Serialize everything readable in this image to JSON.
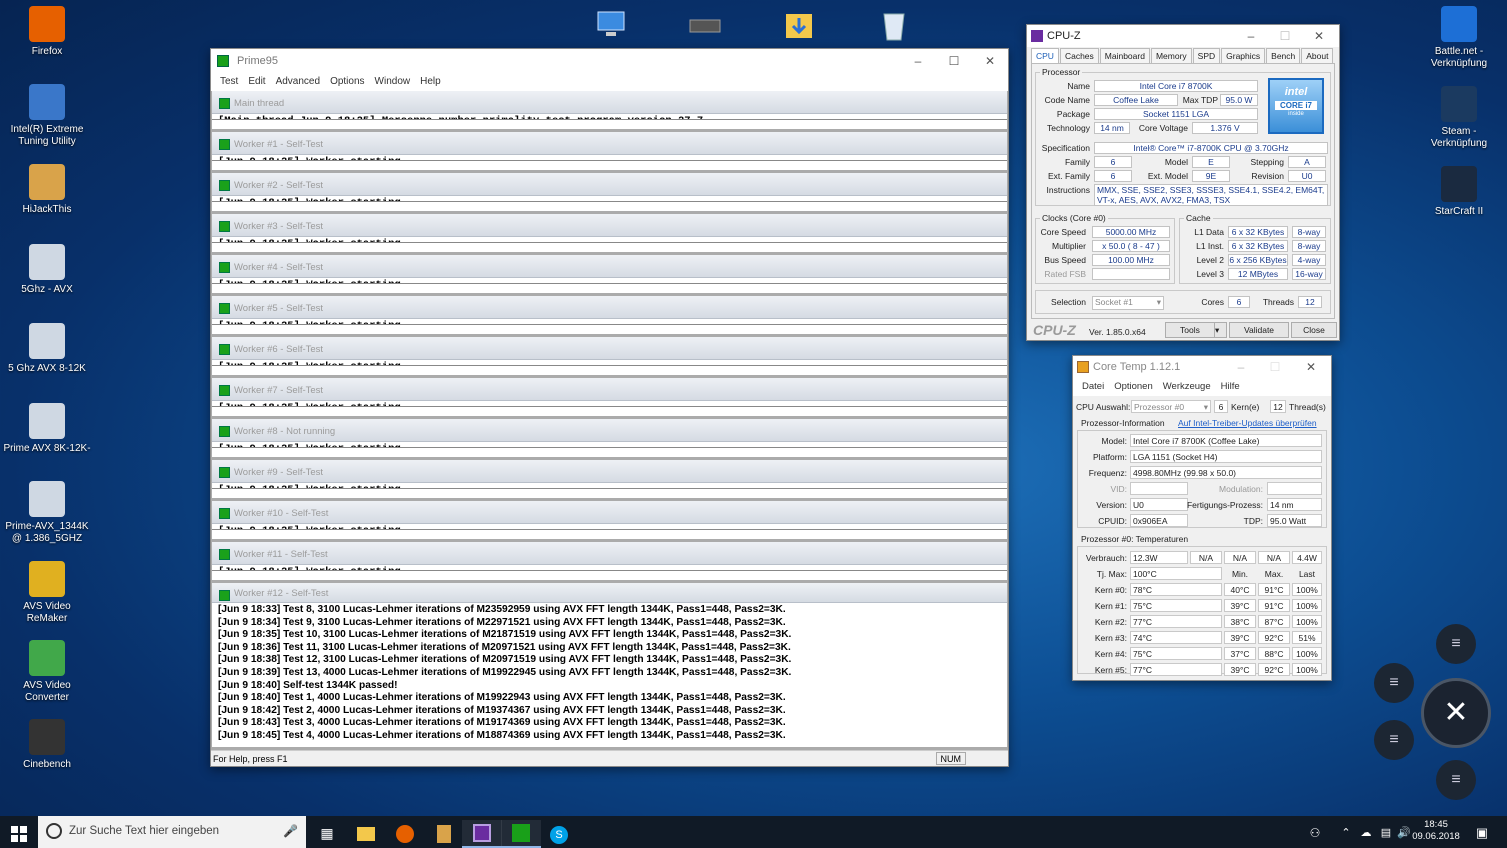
{
  "desktop": {
    "left_icons": [
      {
        "label": "Firefox",
        "icon": "firefox-icon",
        "color": "#e66000"
      },
      {
        "label": "Intel(R) Extreme Tuning Utility",
        "icon": "xtu-icon",
        "color": "#3a77c9"
      },
      {
        "label": "HiJackThis",
        "icon": "hijackthis-icon",
        "color": "#d9a34a"
      },
      {
        "label": "5Ghz - AVX",
        "icon": "shortcut-icon",
        "color": "#cfd8e3"
      },
      {
        "label": "5 Ghz AVX 8-12K",
        "icon": "shortcut-icon",
        "color": "#cfd8e3"
      },
      {
        "label": "Prime AVX 8K-12K-",
        "icon": "shortcut-icon",
        "color": "#cfd8e3"
      },
      {
        "label": "Prime-AVX_1344K @ 1.386_5GHZ",
        "icon": "shortcut-icon",
        "color": "#cfd8e3"
      },
      {
        "label": "AVS Video ReMaker",
        "icon": "avs-remaker-icon",
        "color": "#e0b020"
      },
      {
        "label": "AVS Video Converter",
        "icon": "avs-converter-icon",
        "color": "#41a84a"
      },
      {
        "label": "Cinebench",
        "icon": "cinebench-icon",
        "color": "#333333"
      }
    ],
    "right_icons": [
      {
        "label": "Battle.net - Verknüpfung",
        "icon": "battlenet-icon",
        "color": "#1d6fd6"
      },
      {
        "label": "Steam - Verknüpfung",
        "icon": "steam-icon",
        "color": "#1b3a60"
      },
      {
        "label": "StarCraft II",
        "icon": "starcraft-icon",
        "color": "#1a2a40"
      }
    ]
  },
  "prime95": {
    "title": "Prime95",
    "menu": [
      "Test",
      "Edit",
      "Advanced",
      "Options",
      "Window",
      "Help"
    ],
    "panes": [
      {
        "title": "Main thread",
        "line": "[Main thread Jun 9 18:25] Mersenne number primality test program version 27.7"
      },
      {
        "title": "Worker #1 - Self-Test",
        "line": "[Jun 9 18:25] Worker starting"
      },
      {
        "title": "Worker #2 - Self-Test",
        "line": "[Jun 9 18:25] Worker starting"
      },
      {
        "title": "Worker #3 - Self-Test",
        "line": "[Jun 9 18:25] Worker starting"
      },
      {
        "title": "Worker #4 - Self-Test",
        "line": "[Jun 9 18:25] Worker starting"
      },
      {
        "title": "Worker #5 - Self-Test",
        "line": "[Jun 9 18:25] Worker starting"
      },
      {
        "title": "Worker #6 - Self-Test",
        "line": "[Jun 9 18:25] Worker starting"
      },
      {
        "title": "Worker #7 - Self-Test",
        "line": "[Jun 9 18:25] Worker starting"
      },
      {
        "title": "Worker #8 - Not running",
        "line": "[Jun 9 18:25] Worker starting"
      },
      {
        "title": "Worker #9 - Self-Test",
        "line": "[Jun 9 18:25] Worker starting"
      },
      {
        "title": "Worker #10 - Self-Test",
        "line": "[Jun 9 18:25] Worker starting"
      },
      {
        "title": "Worker #11 - Self-Test",
        "line": "[Jun 9 18:25] Worker starting"
      }
    ],
    "worker12": {
      "title": "Worker #12 - Self-Test",
      "log": [
        "[Jun 9 18:33] Test 8, 3100 Lucas-Lehmer iterations of M23592959 using AVX FFT length 1344K, Pass1=448, Pass2=3K.",
        "[Jun 9 18:34] Test 9, 3100 Lucas-Lehmer iterations of M22971521 using AVX FFT length 1344K, Pass1=448, Pass2=3K.",
        "[Jun 9 18:35] Test 10, 3100 Lucas-Lehmer iterations of M21871519 using AVX FFT length 1344K, Pass1=448, Pass2=3K.",
        "[Jun 9 18:36] Test 11, 3100 Lucas-Lehmer iterations of M20971521 using AVX FFT length 1344K, Pass1=448, Pass2=3K.",
        "[Jun 9 18:38] Test 12, 3100 Lucas-Lehmer iterations of M20971519 using AVX FFT length 1344K, Pass1=448, Pass2=3K.",
        "[Jun 9 18:39] Test 13, 4000 Lucas-Lehmer iterations of M19922945 using AVX FFT length 1344K, Pass1=448, Pass2=3K.",
        "[Jun 9 18:40] Self-test 1344K passed!",
        "[Jun 9 18:40] Test 1, 4000 Lucas-Lehmer iterations of M19922943 using AVX FFT length 1344K, Pass1=448, Pass2=3K.",
        "[Jun 9 18:42] Test 2, 4000 Lucas-Lehmer iterations of M19374367 using AVX FFT length 1344K, Pass1=448, Pass2=3K.",
        "[Jun 9 18:43] Test 3, 4000 Lucas-Lehmer iterations of M19174369 using AVX FFT length 1344K, Pass1=448, Pass2=3K.",
        "[Jun 9 18:45] Test 4, 4000 Lucas-Lehmer iterations of M18874369 using AVX FFT length 1344K, Pass1=448, Pass2=3K."
      ]
    },
    "status": "For Help, press F1",
    "num": "NUM"
  },
  "cpuz": {
    "title": "CPU-Z",
    "tabs": [
      "CPU",
      "Caches",
      "Mainboard",
      "Memory",
      "SPD",
      "Graphics",
      "Bench",
      "About"
    ],
    "processor_label": "Processor",
    "name_label": "Name",
    "name": "Intel Core i7 8700K",
    "codename_label": "Code Name",
    "codename": "Coffee Lake",
    "maxtdp_label": "Max TDP",
    "maxtdp": "95.0 W",
    "package_label": "Package",
    "package": "Socket 1151 LGA",
    "technology_label": "Technology",
    "technology": "14 nm",
    "corevoltage_label": "Core Voltage",
    "corevoltage": "1.376 V",
    "spec_label": "Specification",
    "spec": "Intel® Core™ i7-8700K CPU @ 3.70GHz",
    "family_label": "Family",
    "family": "6",
    "model_label": "Model",
    "model": "E",
    "stepping_label": "Stepping",
    "stepping": "A",
    "extfamily_label": "Ext. Family",
    "extfamily": "6",
    "extmodel_label": "Ext. Model",
    "extmodel": "9E",
    "revision_label": "Revision",
    "revision": "U0",
    "instructions_label": "Instructions",
    "instructions": "MMX, SSE, SSE2, SSE3, SSSE3, SSE4.1, SSE4.2, EM64T, VT-x, AES, AVX, AVX2, FMA3, TSX",
    "intel_logo": {
      "brand": "intel",
      "line1": "CORE i7",
      "line2": "inside"
    },
    "clocks_label": "Clocks (Core #0)",
    "corespeed_label": "Core Speed",
    "corespeed": "5000.00 MHz",
    "multiplier_label": "Multiplier",
    "multiplier": "x 50.0 ( 8 - 47 )",
    "busspeed_label": "Bus Speed",
    "busspeed": "100.00 MHz",
    "ratedfsb_label": "Rated FSB",
    "ratedfsb": "",
    "cache_label": "Cache",
    "l1data_label": "L1 Data",
    "l1data": "6 x 32 KBytes",
    "l1data_way": "8-way",
    "l1inst_label": "L1 Inst.",
    "l1inst": "6 x 32 KBytes",
    "l1inst_way": "8-way",
    "l2_label": "Level 2",
    "l2": "6 x 256 KBytes",
    "l2_way": "4-way",
    "l3_label": "Level 3",
    "l3": "12 MBytes",
    "l3_way": "16-way",
    "selection_label": "Selection",
    "selection": "Socket #1",
    "cores_label": "Cores",
    "cores": "6",
    "threads_label": "Threads",
    "threads": "12",
    "brand": "CPU-Z",
    "version": "Ver. 1.85.0.x64",
    "tools": "Tools",
    "validate": "Validate",
    "close": "Close"
  },
  "coretemp": {
    "title": "Core Temp 1.12.1",
    "menu": [
      "Datei",
      "Optionen",
      "Werkzeuge",
      "Hilfe"
    ],
    "cpu_select_label": "CPU Auswahl:",
    "cpu_select": "Prozessor #0",
    "cores_count": "6",
    "cores_word": "Kern(e)",
    "threads_count": "12",
    "threads_word": "Thread(s)",
    "proc_info_label": "Prozessor-Information",
    "update_link": "Auf Intel-Treiber-Updates überprüfen",
    "model_label": "Model:",
    "model": "Intel Core i7 8700K (Coffee Lake)",
    "platform_label": "Platform:",
    "platform": "LGA 1151 (Socket H4)",
    "freq_label": "Frequenz:",
    "freq": "4998.80MHz (99.98 x 50.0)",
    "vid_label": "VID:",
    "vid": "",
    "modulation_label": "Modulation:",
    "modulation": "",
    "version_label": "Version:",
    "version": "U0",
    "process_label": "Fertigungs-Prozess:",
    "process": "14 nm",
    "cpuid_label": "CPUID:",
    "cpuid": "0x906EA",
    "tdp_label": "TDP:",
    "tdp": "95.0 Watt",
    "temps_label": "Prozessor #0: Temperaturen",
    "power_label": "Verbrauch:",
    "power": [
      "12.3W",
      "N/A",
      "N/A",
      "N/A",
      "4.4W"
    ],
    "tjmax_label": "Tj. Max:",
    "tjmax": "100°C",
    "hdr": [
      "Min.",
      "Max.",
      "Last"
    ],
    "cores": [
      {
        "label": "Kern #0:",
        "temp": "78°C",
        "min": "40°C",
        "max": "91°C",
        "load": "100%"
      },
      {
        "label": "Kern #1:",
        "temp": "75°C",
        "min": "39°C",
        "max": "91°C",
        "load": "100%"
      },
      {
        "label": "Kern #2:",
        "temp": "77°C",
        "min": "38°C",
        "max": "87°C",
        "load": "100%"
      },
      {
        "label": "Kern #3:",
        "temp": "74°C",
        "min": "39°C",
        "max": "92°C",
        "load": "51%"
      },
      {
        "label": "Kern #4:",
        "temp": "75°C",
        "min": "37°C",
        "max": "88°C",
        "load": "100%"
      },
      {
        "label": "Kern #5:",
        "temp": "77°C",
        "min": "39°C",
        "max": "92°C",
        "load": "100%"
      }
    ]
  },
  "taskbar": {
    "search_placeholder": "Zur Suche Text hier eingeben",
    "time": "18:45",
    "date": "09.06.2018"
  }
}
